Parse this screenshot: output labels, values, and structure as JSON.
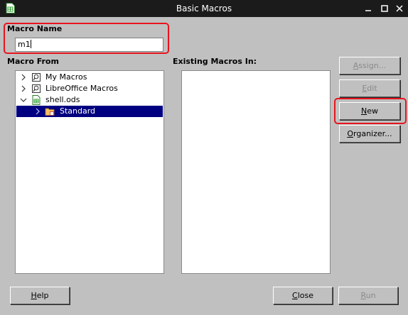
{
  "window": {
    "title": "Basic Macros",
    "app_icon": "spreadsheet-doc-icon"
  },
  "macro_name": {
    "label": "Macro Name",
    "value": "m1"
  },
  "macro_from": {
    "label": "Macro From",
    "items": [
      {
        "label": "My Macros",
        "icon": "macro-library-icon",
        "expander": "chevron-right-icon",
        "selected": false
      },
      {
        "label": "LibreOffice Macros",
        "icon": "macro-library-icon",
        "expander": "chevron-right-icon",
        "selected": false
      },
      {
        "label": "shell.ods",
        "icon": "spreadsheet-doc-icon",
        "expander": "chevron-down-icon",
        "selected": false
      },
      {
        "label": "Standard",
        "icon": "folder-icon",
        "expander": "chevron-right-icon",
        "selected": true
      }
    ]
  },
  "existing_macros": {
    "label": "Existing Macros In:",
    "items": []
  },
  "buttons": {
    "assign": {
      "pre": "",
      "u": "A",
      "post": "ssign...",
      "enabled": false
    },
    "edit": {
      "pre": "",
      "u": "E",
      "post": "dit",
      "enabled": false
    },
    "new": {
      "pre": "",
      "u": "N",
      "post": "ew",
      "enabled": true
    },
    "organizer": {
      "pre": "",
      "u": "O",
      "post": "rganizer...",
      "enabled": true
    },
    "help": {
      "pre": "",
      "u": "H",
      "post": "elp",
      "enabled": true
    },
    "close": {
      "pre": "",
      "u": "C",
      "post": "lose",
      "enabled": true
    },
    "run": {
      "pre": "",
      "u": "R",
      "post": "un",
      "enabled": false
    }
  },
  "colors": {
    "highlight": "#e8141e",
    "selection": "#000080",
    "dialog_bg": "#c0c0c0",
    "titlebar_bg": "#1b1b1b"
  }
}
